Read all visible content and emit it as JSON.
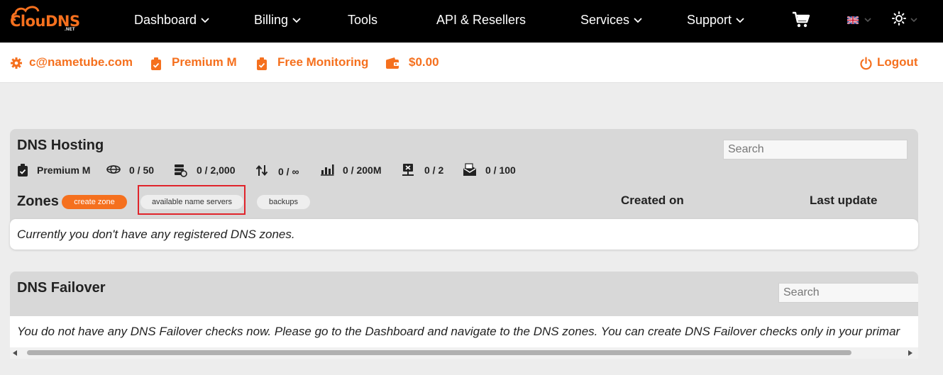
{
  "brand": {
    "name": "ClouDNS",
    "suffix": ".NET",
    "accent": "#f5701e"
  },
  "nav": {
    "items": [
      {
        "label": "Dashboard",
        "has_dropdown": true
      },
      {
        "label": "Billing",
        "has_dropdown": true
      },
      {
        "label": "Tools",
        "has_dropdown": false
      },
      {
        "label": "API & Resellers",
        "has_dropdown": false
      },
      {
        "label": "Services",
        "has_dropdown": true
      },
      {
        "label": "Support",
        "has_dropdown": true
      }
    ],
    "icons": [
      "cart-icon",
      "uk-flag-icon",
      "theme-sun-icon"
    ]
  },
  "account": {
    "email": "c@nametube.com",
    "plan": "Premium M",
    "monitoring": "Free Monitoring",
    "balance": "$0.00",
    "logout": "Logout"
  },
  "dns_hosting": {
    "title": "DNS Hosting",
    "search_placeholder": "Search",
    "stats": [
      {
        "icon": "plan-badge-icon",
        "value": "Premium M"
      },
      {
        "icon": "zones-globe-icon",
        "value": "0 / 50"
      },
      {
        "icon": "records-server-icon",
        "value": "0 / 2,000"
      },
      {
        "icon": "transfer-arrows-icon",
        "value": "0 / ∞"
      },
      {
        "icon": "queries-chart-icon",
        "value": "0 / 200M"
      },
      {
        "icon": "network-icon",
        "value": "0 / 2"
      },
      {
        "icon": "mail-forward-icon",
        "value": "0 / 100"
      }
    ],
    "zones_label": "Zones",
    "create_zone": "create zone",
    "available_ns": "available name servers",
    "backups": "backups",
    "col_created": "Created on",
    "col_updated": "Last update",
    "empty_message": "Currently you don't have any registered DNS zones."
  },
  "dns_failover": {
    "title": "DNS Failover",
    "search_placeholder": "Search",
    "empty_message": "You do not have any DNS Failover checks now. Please go to the Dashboard and navigate to the DNS zones. You can create DNS Failover checks only in your primar"
  }
}
